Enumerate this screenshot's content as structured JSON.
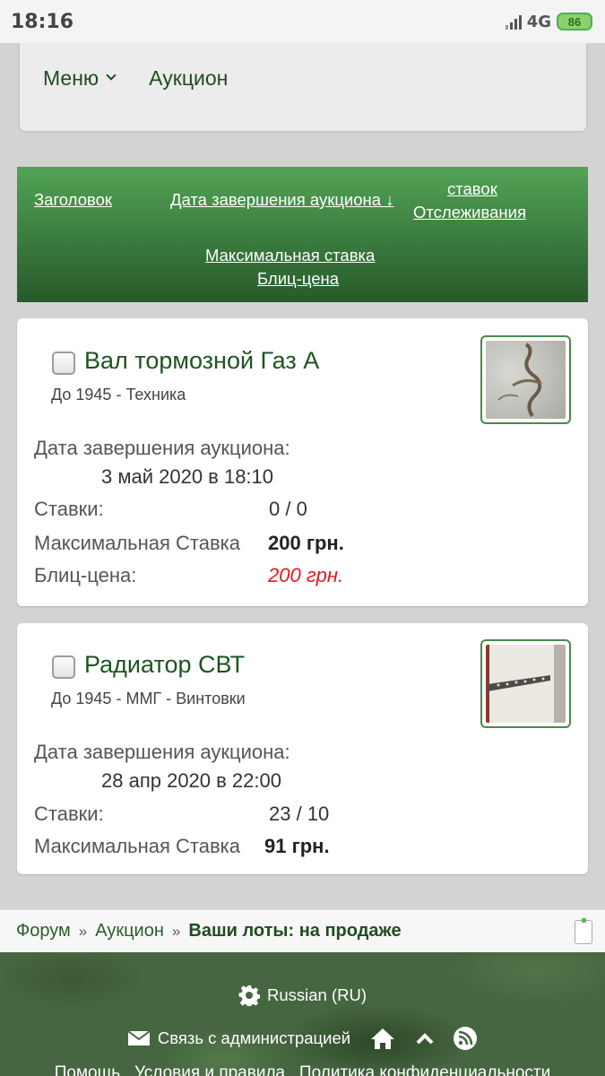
{
  "status_bar": {
    "time": "18:16",
    "network": "4G",
    "battery": "86"
  },
  "nav": {
    "menu_label": "Меню",
    "auction_label": "Аукцион"
  },
  "sort": {
    "title": "Заголовок",
    "end_date": "Дата завершения аукциона ↓",
    "bids": "ставок",
    "watching": "Отслеживания",
    "max_bid": "Максимальная ставка",
    "blitz": "Блиц-цена"
  },
  "lots": [
    {
      "title": "Вал тормозной Газ А",
      "category": "До 1945 - Техника",
      "end_label": "Дата завершения аукциона:",
      "end_value": "3 май 2020 в 18:10",
      "bids_label": "Ставки:",
      "bids_value": "0 / 0",
      "max_label": "Максимальная Ставка",
      "max_value": "200 грн.",
      "blitz_label": "Блиц-цена:",
      "blitz_value": "200 грн."
    },
    {
      "title": "Радиатор СВТ",
      "category": "До 1945 - ММГ - Винтовки",
      "end_label": "Дата завершения аукциона:",
      "end_value": "28 апр 2020 в 22:00",
      "bids_label": "Ставки:",
      "bids_value": "23 / 10",
      "max_label": "Максимальная Ставка",
      "max_value": "91 грн."
    }
  ],
  "breadcrumb": {
    "forum": "Форум",
    "sep": "»",
    "auction": "Аукцион",
    "current": "Ваши лоты: на продаже"
  },
  "footer": {
    "language": "Russian (RU)",
    "contact": "Связь с администрацией",
    "links": "Помощь   Условия и правила   Политика конфиденциальности"
  }
}
